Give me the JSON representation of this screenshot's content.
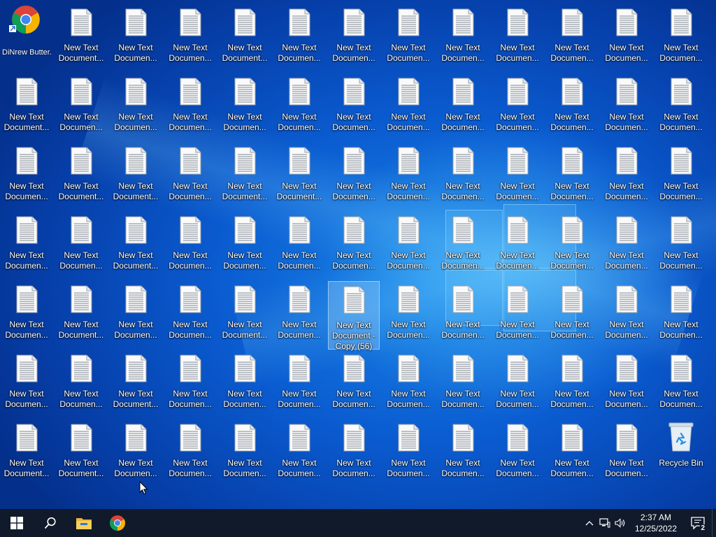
{
  "desktop": {
    "gadget": {
      "label": "DiNrew Butter..."
    },
    "grid_rows": 7,
    "grid_cols": 13,
    "columns_x": [
      38,
      116,
      194,
      272,
      350,
      428,
      506,
      584,
      662,
      740,
      818,
      896,
      974
    ],
    "rows_y": [
      6,
      105,
      204,
      303,
      402,
      501,
      600
    ],
    "default_line1": "New Text",
    "variants": {
      "a": "Document...",
      "b": "Documen..."
    },
    "label_pattern": [
      [
        "gadget",
        "a",
        "b",
        "b",
        "a",
        "b",
        "b",
        "b",
        "b",
        "b",
        "b",
        "b",
        "b"
      ],
      [
        "a",
        "b",
        "b",
        "b",
        "b",
        "b",
        "b",
        "b",
        "b",
        "b",
        "b",
        "b",
        "b"
      ],
      [
        "b",
        "a",
        "a",
        "b",
        "a",
        "a",
        "b",
        "b",
        "b",
        "b",
        "b",
        "b",
        "b"
      ],
      [
        "b",
        "b",
        "a",
        "b",
        "b",
        "b",
        "b",
        "b",
        "b",
        "b",
        "b",
        "b",
        "b"
      ],
      [
        "b",
        "a",
        "b",
        "b",
        "a",
        "b",
        "sel",
        "b",
        "b",
        "b",
        "b",
        "b",
        "b"
      ],
      [
        "b",
        "b",
        "a",
        "b",
        "b",
        "b",
        "b",
        "b",
        "b",
        "b",
        "b",
        "b",
        "b"
      ],
      [
        "a",
        "a",
        "b",
        "b",
        "b",
        "b",
        "b",
        "b",
        "b",
        "b",
        "b",
        "b",
        "bin"
      ]
    ],
    "selected_label": [
      "New Text",
      "Document -",
      "Copy (56)"
    ],
    "recycle_bin": {
      "label": "Recycle Bin"
    }
  },
  "taskbar": {
    "clock": {
      "time": "2:37 AM",
      "date": "12/25/2022"
    },
    "notification_count": "2"
  }
}
